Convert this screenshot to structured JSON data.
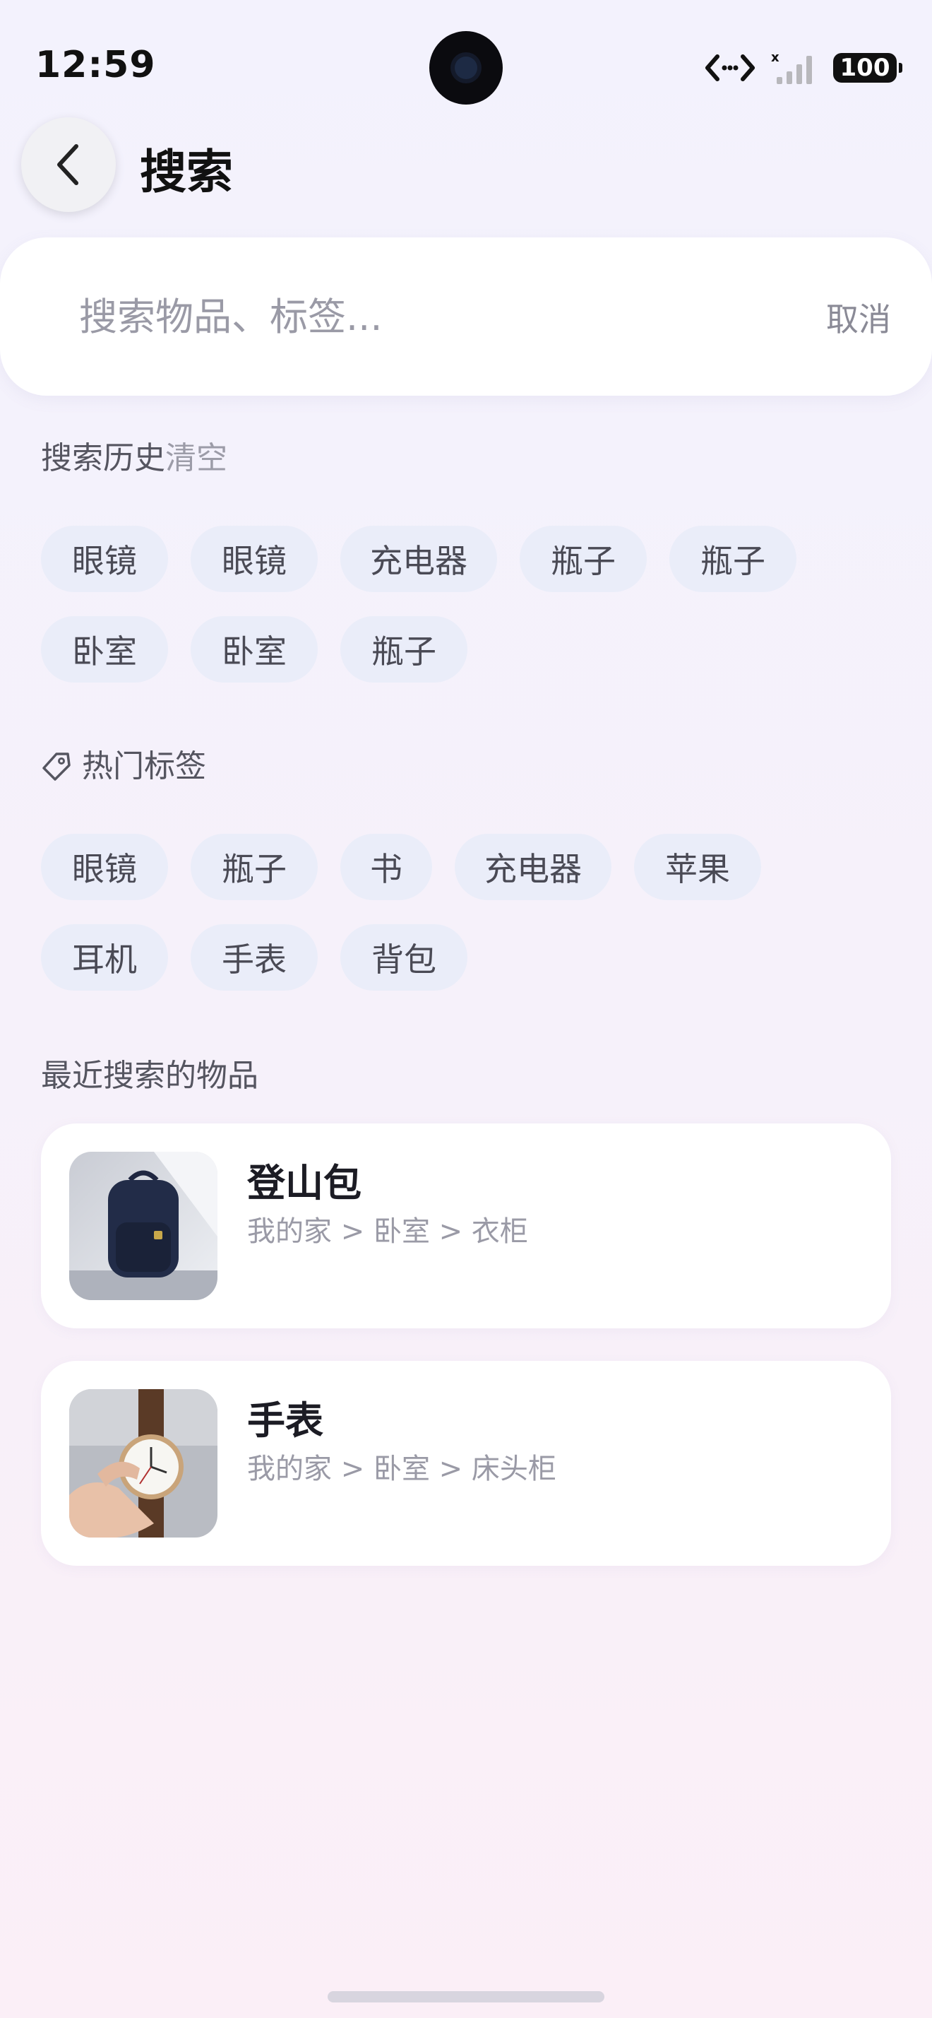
{
  "status_bar": {
    "time": "12:59",
    "battery": "100"
  },
  "header": {
    "title": "搜索"
  },
  "search": {
    "placeholder": "搜索物品、标签...",
    "value": "",
    "cancel_label": "取消"
  },
  "history": {
    "title": "搜索历史",
    "clear_label": "清空",
    "rows": [
      [
        "眼镜",
        "眼镜",
        "充电器",
        "瓶子",
        "瓶子"
      ],
      [
        "卧室",
        "卧室",
        "瓶子"
      ]
    ]
  },
  "hot_tags": {
    "title": "热门标签",
    "rows": [
      [
        "眼镜",
        "瓶子",
        "书",
        "充电器",
        "苹果"
      ],
      [
        "耳机",
        "手表",
        "背包"
      ]
    ]
  },
  "recent_items": {
    "title": "最近搜索的物品",
    "items": [
      {
        "name": "登山包",
        "path": "我的家 > 卧室 > 衣柜",
        "thumb_icon": "backpack-photo"
      },
      {
        "name": "手表",
        "path": "我的家 > 卧室 > 床头柜",
        "thumb_icon": "watch-photo"
      }
    ]
  }
}
